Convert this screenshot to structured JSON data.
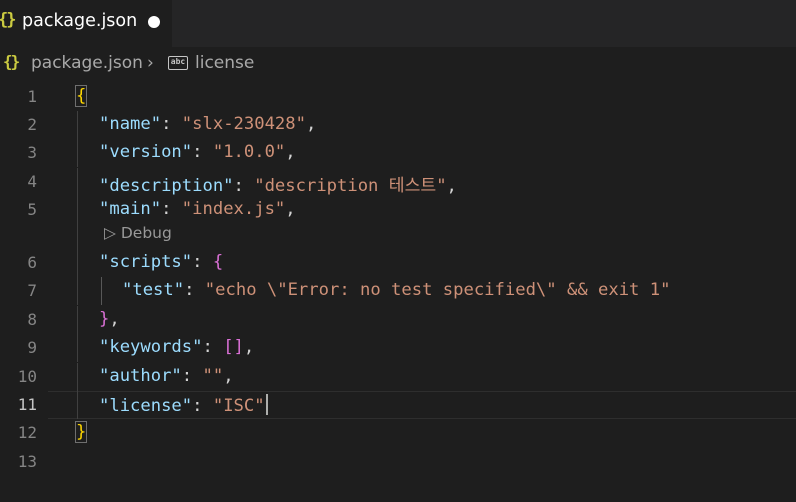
{
  "tab": {
    "icon": "{}",
    "title": "package.json",
    "dirty": true
  },
  "breadcrumb": {
    "icon": "{}",
    "file": "package.json",
    "separator": "›",
    "symbol_icon": "abc",
    "symbol": "license"
  },
  "editor": {
    "active_line": 11,
    "codelens": "▷ Debug",
    "lines": [
      {
        "n": "1"
      },
      {
        "n": "2"
      },
      {
        "n": "3"
      },
      {
        "n": "4"
      },
      {
        "n": "5"
      },
      {
        "n": "6"
      },
      {
        "n": "7"
      },
      {
        "n": "8"
      },
      {
        "n": "9"
      },
      {
        "n": "10"
      },
      {
        "n": "11"
      },
      {
        "n": "12"
      },
      {
        "n": "13"
      }
    ],
    "tokens": {
      "open_brace": "{",
      "name_key": "\"name\"",
      "name_val": "\"slx-230428\"",
      "version_key": "\"version\"",
      "version_val": "\"1.0.0\"",
      "description_key": "\"description\"",
      "description_val": "\"description 테스트\"",
      "main_key": "\"main\"",
      "main_val": "\"index.js\"",
      "scripts_key": "\"scripts\"",
      "scripts_open": "{",
      "test_key": "\"test\"",
      "test_val": "\"echo \\\"Error: no test specified\\\" && exit 1\"",
      "scripts_close": "}",
      "keywords_key": "\"keywords\"",
      "keywords_val": "[]",
      "author_key": "\"author\"",
      "author_val": "\"\"",
      "license_key": "\"license\"",
      "license_val": "\"ISC\"",
      "close_brace": "}",
      "colon": ": ",
      "comma": ","
    }
  },
  "colors": {
    "background": "#1e1e1e",
    "key": "#9cdcfe",
    "string": "#ce9178",
    "bracket_level1": "#ffd700",
    "bracket_level2": "#da70d6",
    "line_number": "#858585"
  }
}
